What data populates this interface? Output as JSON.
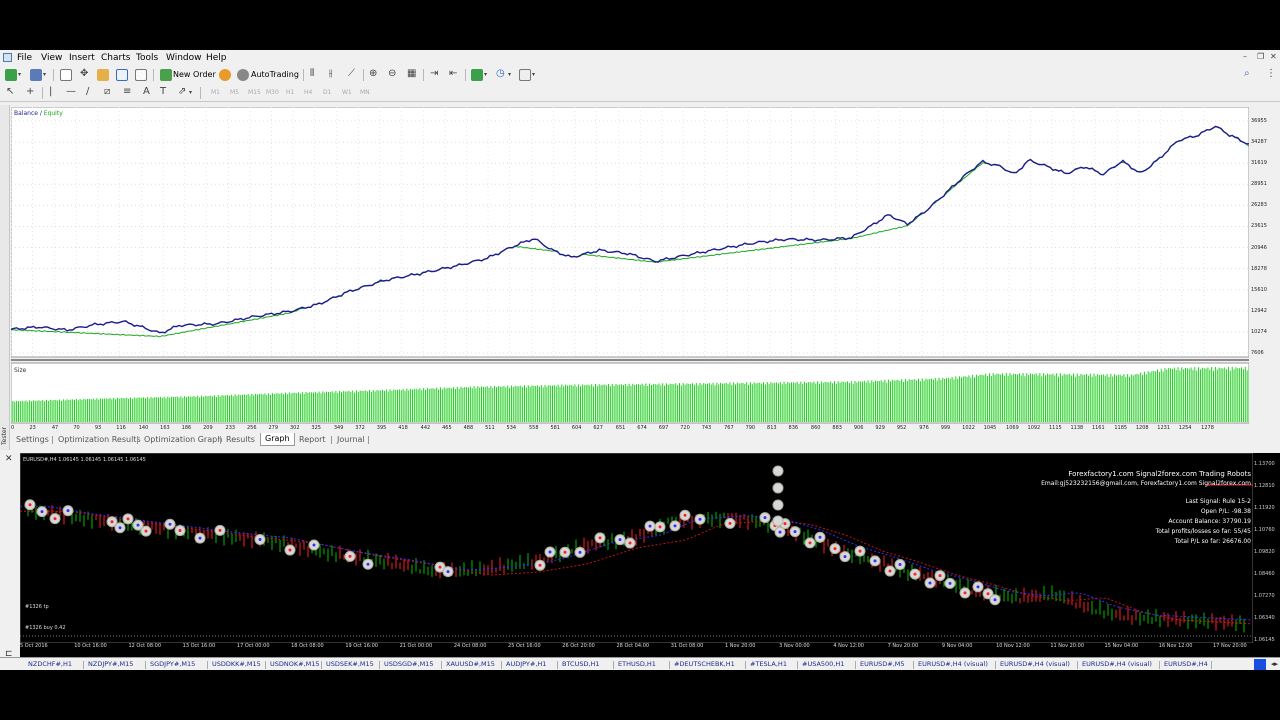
{
  "menu": [
    "File",
    "View",
    "Insert",
    "Charts",
    "Tools",
    "Window",
    "Help"
  ],
  "toolbar": {
    "new_order_label": "New Order",
    "autotrading_label": "AutoTrading"
  },
  "timeframes": [
    "M1",
    "M5",
    "M15",
    "M30",
    "H1",
    "H4",
    "D1",
    "W1",
    "MN"
  ],
  "tester": {
    "side_label": "Tester",
    "legend_balance": "Balance",
    "legend_sep": " / ",
    "legend_equity": "Equity",
    "size_label": "Size",
    "tabs": [
      "Settings",
      "Optimization Results",
      "Optimization Graph",
      "Results",
      "Graph",
      "Report",
      "Journal"
    ],
    "active_tab": "Graph",
    "colors": {
      "balance": "#1c1c8c",
      "equity": "#1ca81c",
      "size_bars": "#22cc22"
    }
  },
  "chart_data": {
    "type": "line",
    "series": [
      {
        "name": "Balance"
      },
      {
        "name": "Equity"
      }
    ],
    "y_ticks": [
      36955,
      34287,
      31619,
      28951,
      26283,
      23615,
      20946,
      18278,
      15610,
      12942,
      10274,
      7606
    ],
    "ylim": [
      7606,
      36955
    ],
    "x_ticks": [
      0,
      23,
      47,
      70,
      93,
      116,
      140,
      163,
      186,
      209,
      233,
      256,
      279,
      302,
      325,
      349,
      372,
      395,
      418,
      442,
      465,
      488,
      511,
      534,
      558,
      581,
      604,
      627,
      651,
      674,
      697,
      720,
      743,
      767,
      790,
      813,
      836,
      860,
      883,
      906,
      929,
      952,
      976,
      999,
      1022,
      1045,
      1069,
      1092,
      1115,
      1138,
      1161,
      1185,
      1208,
      1231,
      1254,
      1278
    ],
    "xlim": [
      0,
      1326
    ],
    "balance_points": [
      [
        0,
        10600
      ],
      [
        30,
        10900
      ],
      [
        60,
        10500
      ],
      [
        90,
        11200
      ],
      [
        120,
        11600
      ],
      [
        140,
        10900
      ],
      [
        160,
        10100
      ],
      [
        180,
        11100
      ],
      [
        220,
        11300
      ],
      [
        260,
        12200
      ],
      [
        300,
        12900
      ],
      [
        330,
        13800
      ],
      [
        360,
        15300
      ],
      [
        400,
        16800
      ],
      [
        440,
        17700
      ],
      [
        480,
        18700
      ],
      [
        510,
        19600
      ],
      [
        540,
        21200
      ],
      [
        560,
        22100
      ],
      [
        580,
        20600
      ],
      [
        600,
        19700
      ],
      [
        630,
        20600
      ],
      [
        660,
        20200
      ],
      [
        690,
        19200
      ],
      [
        720,
        19900
      ],
      [
        760,
        20800
      ],
      [
        800,
        21600
      ],
      [
        830,
        22000
      ],
      [
        870,
        21900
      ],
      [
        900,
        22200
      ],
      [
        920,
        23600
      ],
      [
        940,
        25100
      ],
      [
        960,
        23900
      ],
      [
        980,
        25600
      ],
      [
        1000,
        27700
      ],
      [
        1020,
        29900
      ],
      [
        1040,
        31800
      ],
      [
        1060,
        31200
      ],
      [
        1075,
        30200
      ],
      [
        1090,
        32000
      ],
      [
        1110,
        31200
      ],
      [
        1130,
        30300
      ],
      [
        1150,
        31200
      ],
      [
        1170,
        30200
      ],
      [
        1190,
        31900
      ],
      [
        1210,
        30300
      ],
      [
        1230,
        32200
      ],
      [
        1250,
        34500
      ],
      [
        1270,
        35100
      ],
      [
        1290,
        36300
      ],
      [
        1305,
        35200
      ],
      [
        1326,
        34000
      ]
    ],
    "equity_points": [
      [
        0,
        10550
      ],
      [
        160,
        9700
      ],
      [
        300,
        12700
      ],
      [
        360,
        15600
      ],
      [
        540,
        21100
      ],
      [
        580,
        20500
      ],
      [
        690,
        19100
      ],
      [
        900,
        22100
      ],
      [
        960,
        23700
      ],
      [
        1040,
        31600
      ],
      [
        1085,
        32900
      ],
      [
        1100,
        31600
      ],
      [
        1190,
        31700
      ],
      [
        1250,
        34600
      ],
      [
        1290,
        36500
      ],
      [
        1326,
        33800
      ]
    ],
    "size_points": [
      [
        0,
        0.37
      ],
      [
        100,
        0.42
      ],
      [
        200,
        0.46
      ],
      [
        300,
        0.52
      ],
      [
        400,
        0.57
      ],
      [
        500,
        0.63
      ],
      [
        600,
        0.66
      ],
      [
        700,
        0.68
      ],
      [
        800,
        0.7
      ],
      [
        900,
        0.72
      ],
      [
        1000,
        0.78
      ],
      [
        1050,
        0.86
      ],
      [
        1100,
        0.86
      ],
      [
        1200,
        0.84
      ],
      [
        1240,
        0.96
      ],
      [
        1326,
        0.97
      ]
    ]
  },
  "trade_chart": {
    "title": "EURUSD#,H4  1.06145 1.06145 1.06145 1.06145",
    "info_line1": "Forexfactory1.com Signal2forex.com Trading Robots",
    "info_line2": "Email:gj523232156@gmail.com, Forexfactory1.com Signal2forex.com",
    "last_signal": "Last Signal: Rule 15-2",
    "open_pl": "Open P/L: -98.38",
    "account_balance": "Account Balance: 37790.19",
    "total_profits": "Total profits/losses so far: 55/45",
    "total_pl": "Total P/L so far: 26676.00",
    "annotation_tp": "#1326 tp",
    "annotation_buy": "#1326 buy 0.42",
    "price_ticks": [
      "1.13700",
      "1.12810",
      "1.11920",
      "1.10760",
      "1.09820",
      "1.08460",
      "1.07270",
      "1.06340",
      "1.06145"
    ],
    "x_labels": [
      "5 Oct 2016",
      "10 Oct 16:00",
      "12 Oct 08:00",
      "13 Oct 16:00",
      "17 Oct 00:00",
      "18 Oct 08:00",
      "19 Oct 16:00",
      "21 Oct 00:00",
      "24 Oct 08:00",
      "25 Oct 16:00",
      "26 Oct 20:00",
      "28 Oct 04:00",
      "31 Oct 08:00",
      "1 Nov 20:00",
      "3 Nov 00:00",
      "4 Nov 12:00",
      "7 Nov 20:00",
      "9 Nov 04:00",
      "10 Nov 12:00",
      "11 Nov 20:00",
      "15 Nov 04:00",
      "16 Nov 12:00",
      "17 Nov 20:00"
    ],
    "colors": {
      "bull": "#00c000",
      "bear": "#ff2020",
      "ma_blue": "#3030ff",
      "ma_red": "#cc1010"
    }
  },
  "symbol_tabs": [
    "NZDCHF#,H1",
    "NZDJPY#,M15",
    "SGDJPY#,M15",
    "USDDKK#,M15",
    "USDNOK#,M15",
    "USDSEK#,M15",
    "USDSGD#,M15",
    "XAUUSD#,M15",
    "AUDJPY#,H1",
    "BTCUSD,H1",
    "ETHUSD,H1",
    "#DEUTSCHEBK,H1",
    "#TESLA,H1",
    "#USA500,H1",
    "EURUSD#,M5",
    "EURUSD#,H4 (visual)",
    "EURUSD#,H4 (visual)",
    "EURUSD#,H4 (visual)",
    "EURUSD#,H4"
  ]
}
